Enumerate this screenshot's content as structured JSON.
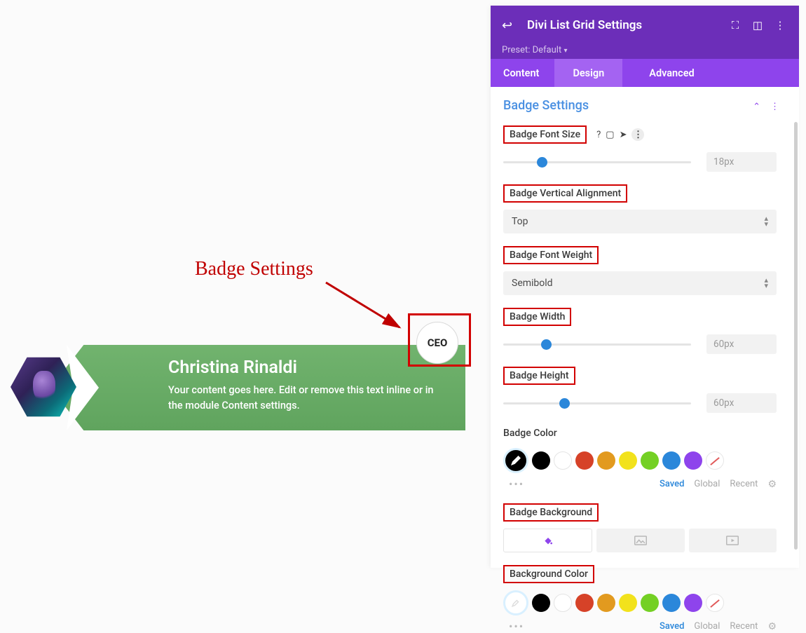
{
  "annotation": {
    "label": "Badge Settings"
  },
  "card": {
    "title": "Christina Rinaldi",
    "desc": "Your content goes here. Edit or remove this text inline or in the module Content settings.",
    "badge_text": "CEO"
  },
  "panel": {
    "title": "Divi List Grid Settings",
    "preset": "Preset: Default",
    "tabs": {
      "content": "Content",
      "design": "Design",
      "advanced": "Advanced"
    },
    "section": "Badge Settings",
    "settings": {
      "font_size": {
        "label": "Badge Font Size",
        "value": "18px",
        "thumb_pct": 18
      },
      "valign": {
        "label": "Badge Vertical Alignment",
        "value": "Top"
      },
      "weight": {
        "label": "Badge Font Weight",
        "value": "Semibold"
      },
      "width": {
        "label": "Badge Width",
        "value": "60px",
        "thumb_pct": 20
      },
      "height": {
        "label": "Badge Height",
        "value": "60px",
        "thumb_pct": 30
      },
      "color": {
        "label": "Badge Color"
      },
      "background": {
        "label": "Badge Background"
      },
      "bgcolor": {
        "label": "Background Color"
      }
    },
    "swatch_palette": [
      "#000000",
      "#ffffff",
      "#d64228",
      "#e29a1f",
      "#f2e21c",
      "#74d024",
      "#2b87da",
      "#8e44ec"
    ],
    "footer": {
      "saved": "Saved",
      "global": "Global",
      "recent": "Recent"
    }
  }
}
